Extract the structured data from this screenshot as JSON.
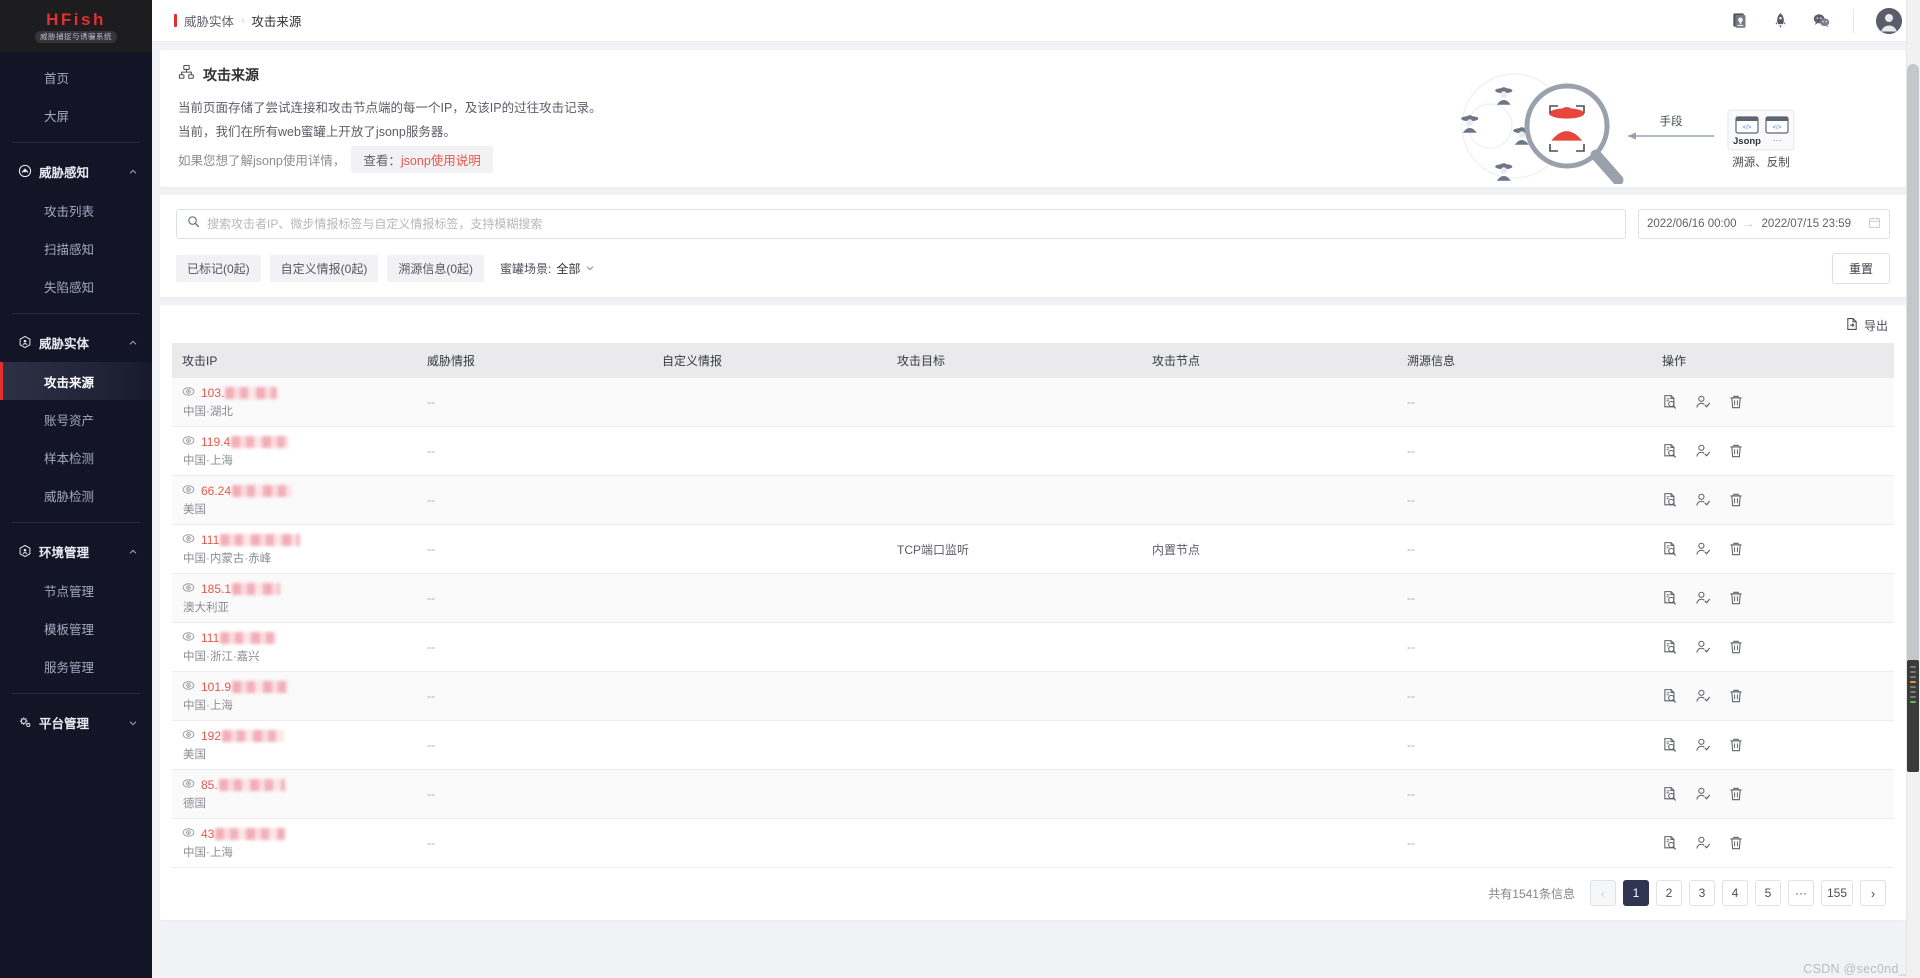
{
  "brand": {
    "name": "HFish",
    "subtitle": "威胁捕捉与诱骗系统"
  },
  "sidebar": {
    "top_links": [
      {
        "label": "首页",
        "name": "sidebar-item-home"
      },
      {
        "label": "大屏",
        "name": "sidebar-item-dashboard"
      }
    ],
    "groups": [
      {
        "label": "威胁感知",
        "icon": "radar-icon",
        "expanded": true,
        "chevron": "chevron-up-icon",
        "items": [
          {
            "label": "攻击列表",
            "name": "sidebar-item-attack-list",
            "active": false
          },
          {
            "label": "扫描感知",
            "name": "sidebar-item-scan-awareness",
            "active": false
          },
          {
            "label": "失陷感知",
            "name": "sidebar-item-compromise-awareness",
            "active": false
          }
        ]
      },
      {
        "label": "威胁实体",
        "icon": "cube-icon",
        "expanded": true,
        "chevron": "chevron-up-icon",
        "items": [
          {
            "label": "攻击来源",
            "name": "sidebar-item-attack-source",
            "active": true
          },
          {
            "label": "账号资产",
            "name": "sidebar-item-account-assets",
            "active": false
          },
          {
            "label": "样本检测",
            "name": "sidebar-item-sample-detection",
            "active": false
          },
          {
            "label": "威胁检测",
            "name": "sidebar-item-threat-detection",
            "active": false
          }
        ]
      },
      {
        "label": "环境管理",
        "icon": "cube-icon",
        "expanded": true,
        "chevron": "chevron-up-icon",
        "items": [
          {
            "label": "节点管理",
            "name": "sidebar-item-node-management",
            "active": false
          },
          {
            "label": "模板管理",
            "name": "sidebar-item-template-management",
            "active": false
          },
          {
            "label": "服务管理",
            "name": "sidebar-item-service-management",
            "active": false
          }
        ]
      },
      {
        "label": "平台管理",
        "icon": "gear-icon",
        "expanded": false,
        "chevron": "chevron-down-icon",
        "items": []
      }
    ]
  },
  "topbar": {
    "breadcrumb": {
      "parent": "威胁实体",
      "separator": "›",
      "current": "攻击来源"
    },
    "icons": [
      "doc-bulb-icon",
      "rocket-icon",
      "wechat-icon"
    ],
    "avatar": "user-avatar"
  },
  "page_header": {
    "icon": "sitemap-icon",
    "title": "攻击来源",
    "line1": "当前页面存储了尝试连接和攻击节点端的每一个IP，及该IP的过往攻击记录。",
    "line2": "当前，我们在所有web蜜罐上开放了jsonp服务器。",
    "note_prefix": "如果您想了解jsonp使用详情，",
    "note_view": "查看：",
    "note_link": "jsonp使用说明",
    "illustration": {
      "arrow_label": "手段",
      "card_label": "Jsonp",
      "card_label2": "···",
      "caption": "溯源、反制"
    }
  },
  "filters": {
    "search_placeholder": "搜索攻击者IP、微步情报标签与自定义情报标签，支持模糊搜索",
    "search_value": "",
    "search_icon": "search-icon",
    "date_start": "2022/06/16 00:00",
    "date_arrow": "→",
    "date_end": "2022/07/15 23:59",
    "calendar_icon": "calendar-icon",
    "chips": [
      "已标记(0起)",
      "自定义情报(0起)",
      "溯源信息(0起)"
    ],
    "scene_label": "蜜罐场景:",
    "scene_value": "全部",
    "scene_chevron": "chevron-down-icon",
    "reset_label": "重置"
  },
  "table": {
    "export_label": "导出",
    "export_icon": "file-export-icon",
    "columns": [
      "攻击IP",
      "威胁情报",
      "自定义情报",
      "攻击目标",
      "攻击节点",
      "溯源信息",
      "操作"
    ],
    "row_actions": [
      "doc-search-icon",
      "user-check-icon",
      "trash-icon"
    ],
    "eye_icon": "eye-icon",
    "empty": "--",
    "rows": [
      {
        "ip_prefix": "103.",
        "mosaic_w": 52,
        "location": "中国·湖北",
        "threat_intel": "--",
        "custom_intel": "",
        "target": "",
        "node": "",
        "trace": "--"
      },
      {
        "ip_prefix": "119.4",
        "mosaic_w": 58,
        "location": "中国·上海",
        "threat_intel": "--",
        "custom_intel": "",
        "target": "",
        "node": "",
        "trace": "--"
      },
      {
        "ip_prefix": "66.24",
        "mosaic_w": 60,
        "location": "美国",
        "threat_intel": "--",
        "custom_intel": "",
        "target": "",
        "node": "",
        "trace": "--"
      },
      {
        "ip_prefix": "111",
        "mosaic_w": 80,
        "location": "中国·内蒙古·赤峰",
        "threat_intel": "--",
        "custom_intel": "",
        "target": "TCP端口监听",
        "node": "内置节点",
        "trace": "--"
      },
      {
        "ip_prefix": "185.1",
        "mosaic_w": 48,
        "location": "澳大利亚",
        "threat_intel": "--",
        "custom_intel": "",
        "target": "",
        "node": "",
        "trace": "--"
      },
      {
        "ip_prefix": "111",
        "mosaic_w": 56,
        "location": "中国·浙江·嘉兴",
        "threat_intel": "--",
        "custom_intel": "",
        "target": "",
        "node": "",
        "trace": "--"
      },
      {
        "ip_prefix": "101.9",
        "mosaic_w": 56,
        "location": "中国·上海",
        "threat_intel": "--",
        "custom_intel": "",
        "target": "",
        "node": "",
        "trace": "--"
      },
      {
        "ip_prefix": "192",
        "mosaic_w": 62,
        "location": "美国",
        "threat_intel": "--",
        "custom_intel": "",
        "target": "",
        "node": "",
        "trace": "--"
      },
      {
        "ip_prefix": "85.",
        "mosaic_w": 66,
        "location": "德国",
        "threat_intel": "--",
        "custom_intel": "",
        "target": "",
        "node": "",
        "trace": "--"
      },
      {
        "ip_prefix": "43",
        "mosaic_w": 70,
        "location": "中国·上海",
        "threat_intel": "--",
        "custom_intel": "",
        "target": "",
        "node": "",
        "trace": "--"
      }
    ]
  },
  "pagination": {
    "total_text": "共有1541条信息",
    "prev": "‹",
    "next": "›",
    "pages": [
      "1",
      "2",
      "3",
      "4",
      "5"
    ],
    "ellipsis": "···",
    "last_page": "155",
    "current": "1"
  },
  "watermark": "CSDN @sec0nd_",
  "colors": {
    "brand_red": "#e03030",
    "link_red": "#e8574b",
    "sidebar_bg": "#131527",
    "active_page": "#2f3550"
  }
}
